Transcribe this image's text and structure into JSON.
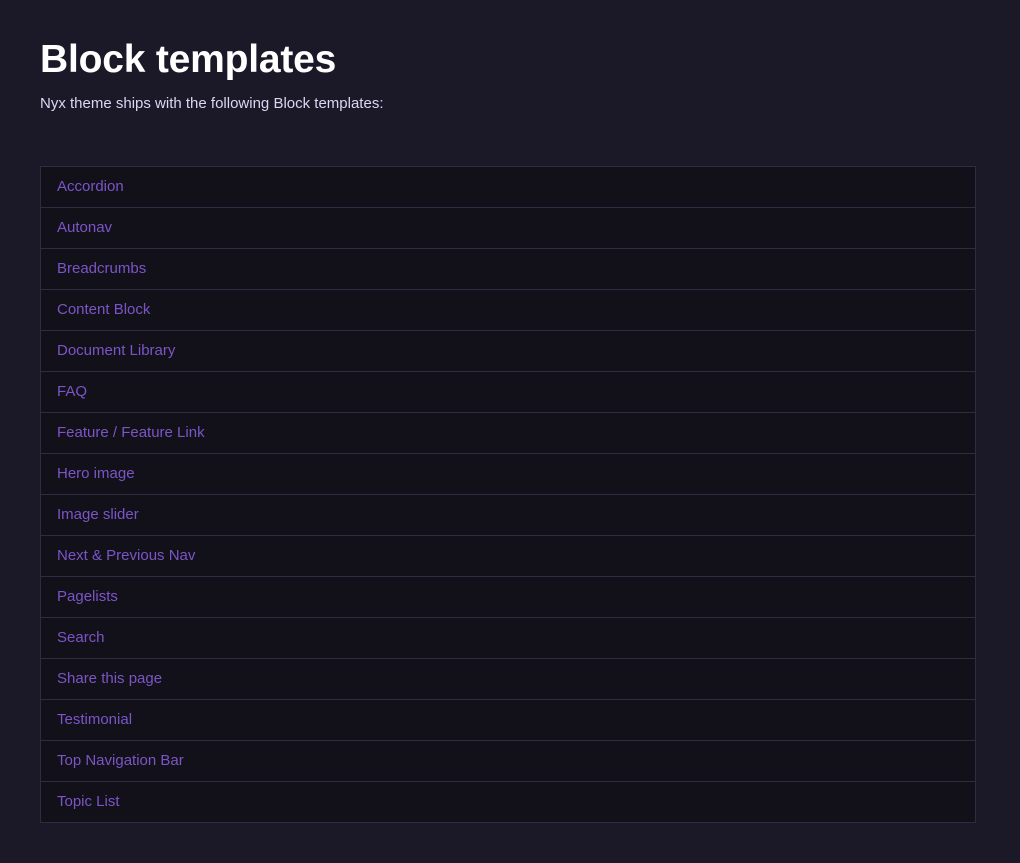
{
  "page": {
    "title": "Block templates",
    "intro": "Nyx theme ships with the following Block templates:"
  },
  "templates": [
    {
      "label": "Accordion"
    },
    {
      "label": "Autonav"
    },
    {
      "label": "Breadcrumbs"
    },
    {
      "label": "Content Block"
    },
    {
      "label": "Document Library"
    },
    {
      "label": "FAQ"
    },
    {
      "label": "Feature / Feature Link"
    },
    {
      "label": "Hero image"
    },
    {
      "label": "Image slider"
    },
    {
      "label": "Next & Previous Nav"
    },
    {
      "label": "Pagelists"
    },
    {
      "label": "Search"
    },
    {
      "label": "Share this page"
    },
    {
      "label": "Testimonial"
    },
    {
      "label": "Top Navigation Bar"
    },
    {
      "label": "Topic List"
    }
  ],
  "colors": {
    "background": "#1b1928",
    "list_background": "#121019",
    "link": "#7b55c7",
    "border": "#2f2c3f",
    "title": "#ffffff",
    "intro": "#dcd6f3"
  }
}
